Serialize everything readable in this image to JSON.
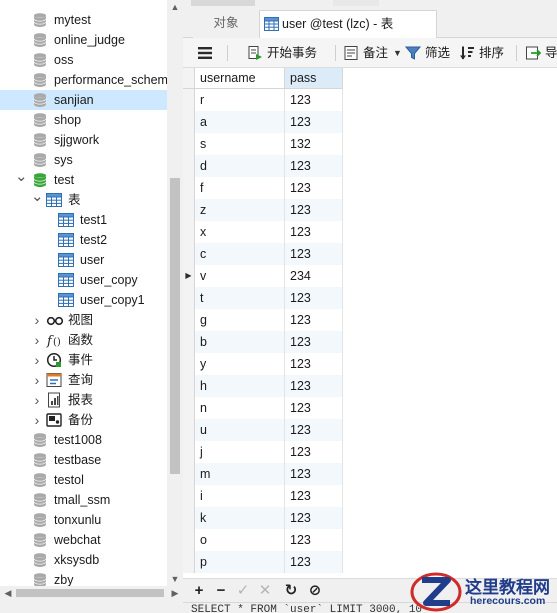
{
  "navigator": {
    "items": [
      {
        "label": "mytest",
        "kind": "database"
      },
      {
        "label": "online_judge",
        "kind": "database"
      },
      {
        "label": "oss",
        "kind": "database"
      },
      {
        "label": "performance_schema",
        "kind": "database"
      },
      {
        "label": "sanjian",
        "kind": "database",
        "selected": true
      },
      {
        "label": "shop",
        "kind": "database"
      },
      {
        "label": "sjjgwork",
        "kind": "database"
      },
      {
        "label": "sys",
        "kind": "database"
      },
      {
        "label": "test",
        "kind": "database-open",
        "expanded": true
      },
      {
        "label": "表",
        "kind": "tables-folder",
        "expanded": true
      },
      {
        "label": "test1",
        "kind": "table"
      },
      {
        "label": "test2",
        "kind": "table"
      },
      {
        "label": "user",
        "kind": "table"
      },
      {
        "label": "user_copy",
        "kind": "table"
      },
      {
        "label": "user_copy1",
        "kind": "table"
      },
      {
        "label": "视图",
        "kind": "views-folder"
      },
      {
        "label": "函数",
        "kind": "functions-folder"
      },
      {
        "label": "事件",
        "kind": "events-folder"
      },
      {
        "label": "查询",
        "kind": "queries-folder"
      },
      {
        "label": "报表",
        "kind": "reports-folder"
      },
      {
        "label": "备份",
        "kind": "backups-folder"
      },
      {
        "label": "test1008",
        "kind": "database"
      },
      {
        "label": "testbase",
        "kind": "database"
      },
      {
        "label": "testol",
        "kind": "database"
      },
      {
        "label": "tmall_ssm",
        "kind": "database"
      },
      {
        "label": "tonxunlu",
        "kind": "database"
      },
      {
        "label": "webchat",
        "kind": "database"
      },
      {
        "label": "xksysdb",
        "kind": "database"
      },
      {
        "label": "zby",
        "kind": "database"
      }
    ]
  },
  "tabs": {
    "objects": "对象",
    "active": "user @test (lzc) - 表"
  },
  "toolbar": {
    "begin_transaction": "开始事务",
    "memo": "备注",
    "filter": "筛选",
    "sort": "排序",
    "import": "导"
  },
  "grid": {
    "columns": [
      "username",
      "pass"
    ],
    "current_row": 8,
    "rows": [
      [
        "r",
        "123"
      ],
      [
        "a",
        "123"
      ],
      [
        "s",
        "132"
      ],
      [
        "d",
        "123"
      ],
      [
        "f",
        "123"
      ],
      [
        "z",
        "123"
      ],
      [
        "x",
        "123"
      ],
      [
        "c",
        "123"
      ],
      [
        "v",
        "234"
      ],
      [
        "t",
        "123"
      ],
      [
        "g",
        "123"
      ],
      [
        "b",
        "123"
      ],
      [
        "y",
        "123"
      ],
      [
        "h",
        "123"
      ],
      [
        "n",
        "123"
      ],
      [
        "u",
        "123"
      ],
      [
        "j",
        "123"
      ],
      [
        "m",
        "123"
      ],
      [
        "i",
        "123"
      ],
      [
        "k",
        "123"
      ],
      [
        "o",
        "123"
      ],
      [
        "p",
        "123"
      ]
    ]
  },
  "navbar": {
    "add": "+",
    "delete": "−",
    "apply": "✓",
    "discard": "✕",
    "refresh": "↻",
    "stop": "⊘"
  },
  "sql": "SELECT * FROM `user` LIMIT 3000, 10",
  "watermark": {
    "title": "这里教程网",
    "url": "herecours.com"
  },
  "colors": {
    "selection": "#cde8ff",
    "database_icon": "#a9a9a9",
    "open_database_icon": "#3aa63a",
    "table_icon": "#2f6fb5",
    "brand": "#1f3d8a"
  }
}
